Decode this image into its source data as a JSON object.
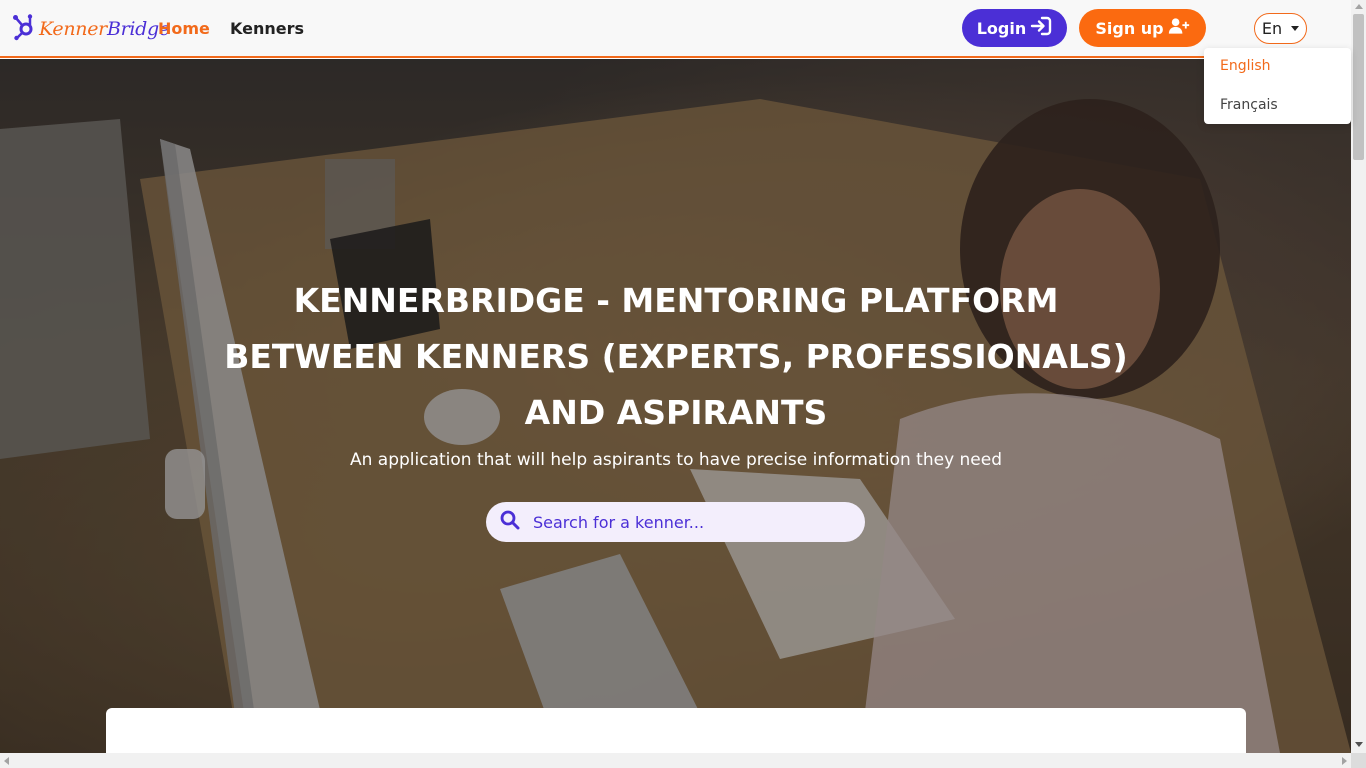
{
  "brand": {
    "name_part1": "Kenner",
    "name_part2": "Bridge",
    "logo_icon": "hub-icon",
    "accent_color": "#f26a1b",
    "primary_color": "#4b2fd6"
  },
  "nav": {
    "home": "Home",
    "kenners": "Kenners"
  },
  "auth": {
    "login": "Login",
    "signup": "Sign up"
  },
  "language": {
    "current": "En",
    "options": [
      "English",
      "Français"
    ],
    "selected": "English"
  },
  "hero": {
    "title": "KENNERBRIDGE - MENTORING PLATFORM BETWEEN KENNERS (EXPERTS, PROFESSIONALS) AND ASPIRANTS",
    "subtitle": "An application that will help aspirants to have precise information they need",
    "search_placeholder": "Search for a kenner..."
  }
}
